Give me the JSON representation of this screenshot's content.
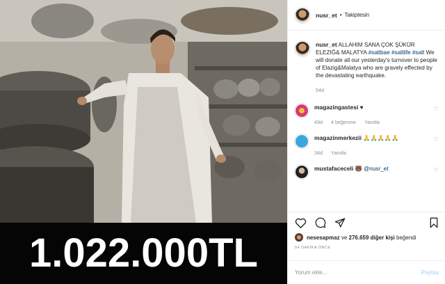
{
  "banner": {
    "amount": "1.022.000TL"
  },
  "header": {
    "username": "nusr_et",
    "separator": "•",
    "follow_status": "Takiptesin"
  },
  "caption": {
    "username": "nusr_et",
    "text_1": "ALLAHIM SANA ÇOK ŞÜKÜR ELEZIĞ& MALATYA",
    "hashtag_1": "#saltbae",
    "hashtag_2": "#saltlife",
    "hashtag_3": "#salt",
    "text_2": "We will donate all our yesterday's turnover to people of Elazig&Malatya who are gravely effected by the devastating earthquake.",
    "age": "54d"
  },
  "comments": [
    {
      "username": "magazingastesi",
      "text": "♥",
      "age": "49d",
      "likes": "4 beğenme",
      "reply": "Yanıtla"
    },
    {
      "username": "magazinmerkezii",
      "text": "🙏🙏🙏🙏🙏",
      "age": "34d",
      "reply": "Yanıtla"
    },
    {
      "username": "mustafaceceli",
      "text": "🐻",
      "mention": "@nusr_et"
    }
  ],
  "actions": {
    "liked_by_user": "nesesapmaz",
    "liked_by_middle": "ve",
    "likes_count": "276.659 diğer kişi",
    "liked_by_suffix": "beğendi",
    "timestamp": "54 DAKİKA ÖNCE"
  },
  "comment_box": {
    "placeholder": "Yorum ekle...",
    "post_label": "Paylaş"
  },
  "colors": {
    "link": "#00376b",
    "muted": "#8e8e8e",
    "post_disabled": "#b3dbff",
    "banner_bg": "#050505"
  }
}
